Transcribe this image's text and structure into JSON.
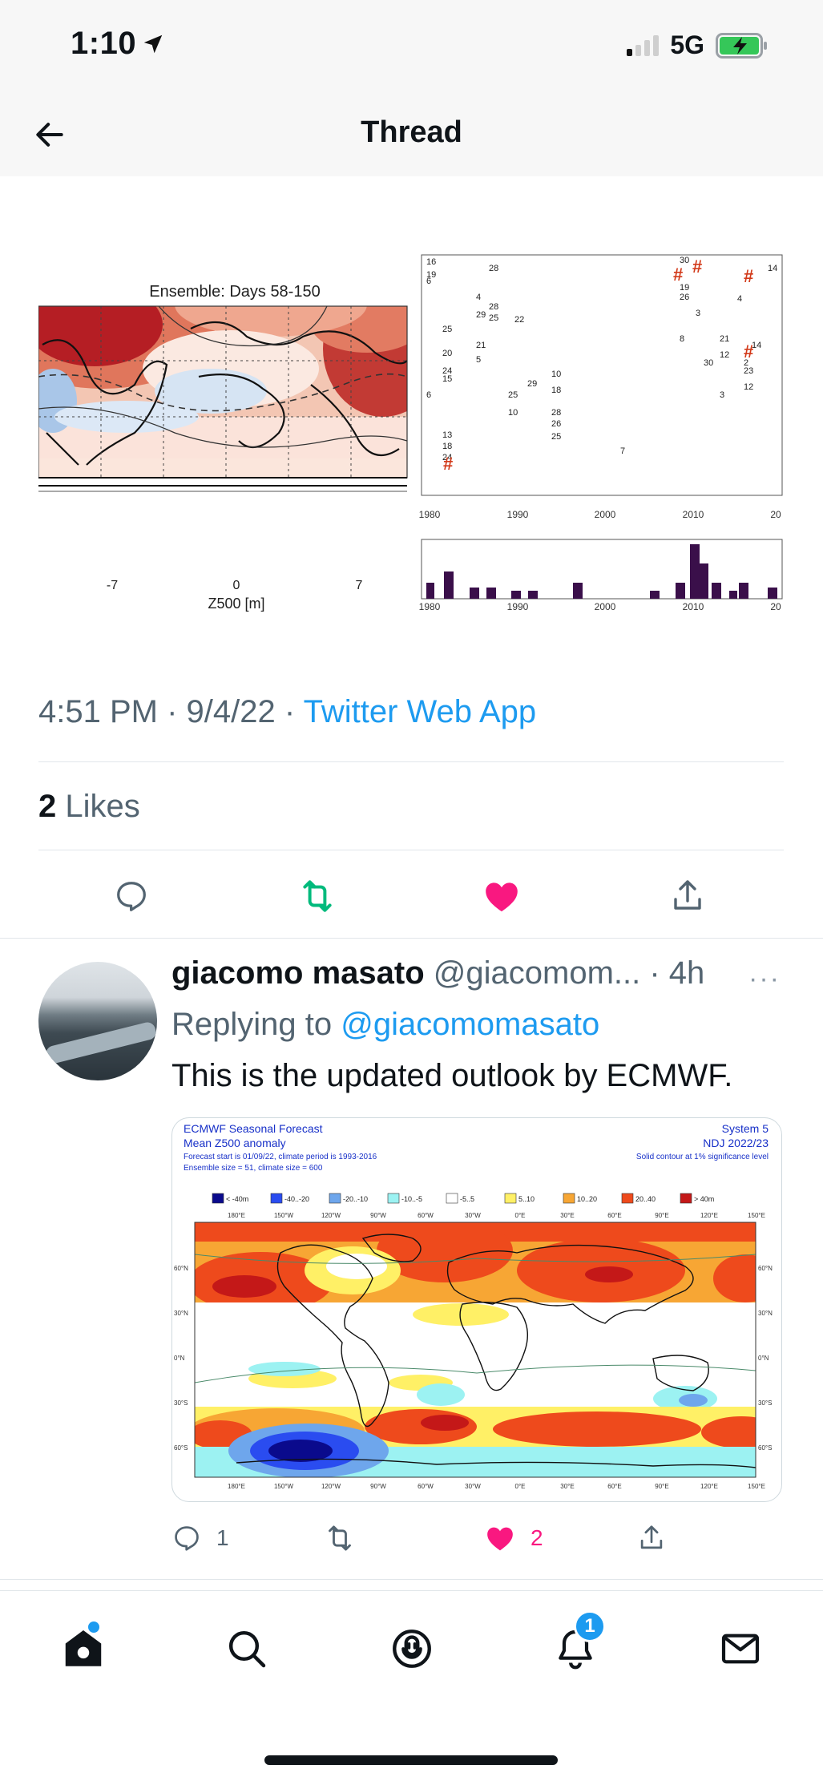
{
  "status_bar": {
    "time": "1:10",
    "network": "5G"
  },
  "nav": {
    "title": "Thread"
  },
  "tweet": {
    "figure": {
      "left_title": "Ensemble: Days 58-150",
      "left_xticks": [
        "-7",
        "0",
        "7"
      ],
      "left_xlabel": "Z500 [m]",
      "right_xticks": [
        "1980",
        "1990",
        "2000",
        "2010",
        "20"
      ],
      "scatter_numbers": [
        "16",
        "28",
        "19",
        "6",
        "4",
        "28",
        "29",
        "25",
        "22",
        "25",
        "21",
        "20",
        "5",
        "24",
        "15",
        "10",
        "29",
        "18",
        "25",
        "10",
        "28",
        "26",
        "25",
        "13",
        "18",
        "24",
        "6",
        "30",
        "19",
        "26",
        "3",
        "8",
        "21",
        "12",
        "30",
        "2",
        "23",
        "14",
        "12",
        "3",
        "4",
        "14",
        "7"
      ]
    },
    "time": "4:51 PM",
    "date": "9/4/22",
    "separator": "·",
    "source": "Twitter Web App",
    "likes_count": "2",
    "likes_label": "Likes"
  },
  "reply": {
    "name": "giacomo masato",
    "handle": "@giacomom...",
    "age": "· 4h",
    "more": "···",
    "replying_prefix": "Replying to",
    "replying_handle": "@giacomomasato",
    "text": "This is the updated outlook by ECMWF.",
    "media": {
      "title_left_1": "ECMWF Seasonal Forecast",
      "title_left_2": "Mean Z500 anomaly",
      "title_left_3": "Forecast start is 01/09/22, climate period is 1993-2016",
      "title_left_4": "Ensemble size = 51, climate size = 600",
      "title_right_1": "System 5",
      "title_right_2": "NDJ 2022/23",
      "title_right_3": "Solid contour at 1% significance level",
      "legend": [
        {
          "label": "< -40m",
          "color": "#0a0a8c"
        },
        {
          "label": "-40..-20",
          "color": "#2a4cf0"
        },
        {
          "label": "-20..-10",
          "color": "#6ea6ec"
        },
        {
          "label": "-10..-5",
          "color": "#9cf2f2"
        },
        {
          "label": "-5..5",
          "color": "#ffffff"
        },
        {
          "label": "5..10",
          "color": "#fff066"
        },
        {
          "label": "10..20",
          "color": "#f7a634"
        },
        {
          "label": "20..40",
          "color": "#ee4a1c"
        },
        {
          "label": "> 40m",
          "color": "#c41818"
        }
      ],
      "lon_labels": [
        "180°E",
        "150°W",
        "120°W",
        "90°W",
        "60°W",
        "30°W",
        "0°E",
        "30°E",
        "60°E",
        "90°E",
        "120°E",
        "150°E"
      ],
      "lat_labels": [
        "60°N",
        "30°N",
        "0°N",
        "30°S",
        "60°S"
      ]
    },
    "reply_count": "1",
    "like_count": "2"
  },
  "bottom_nav": {
    "notifications_badge": "1"
  },
  "colors": {
    "accent": "#1d9bf0",
    "like": "#f91880",
    "retweet": "#00ba7c",
    "muted": "#536471"
  }
}
